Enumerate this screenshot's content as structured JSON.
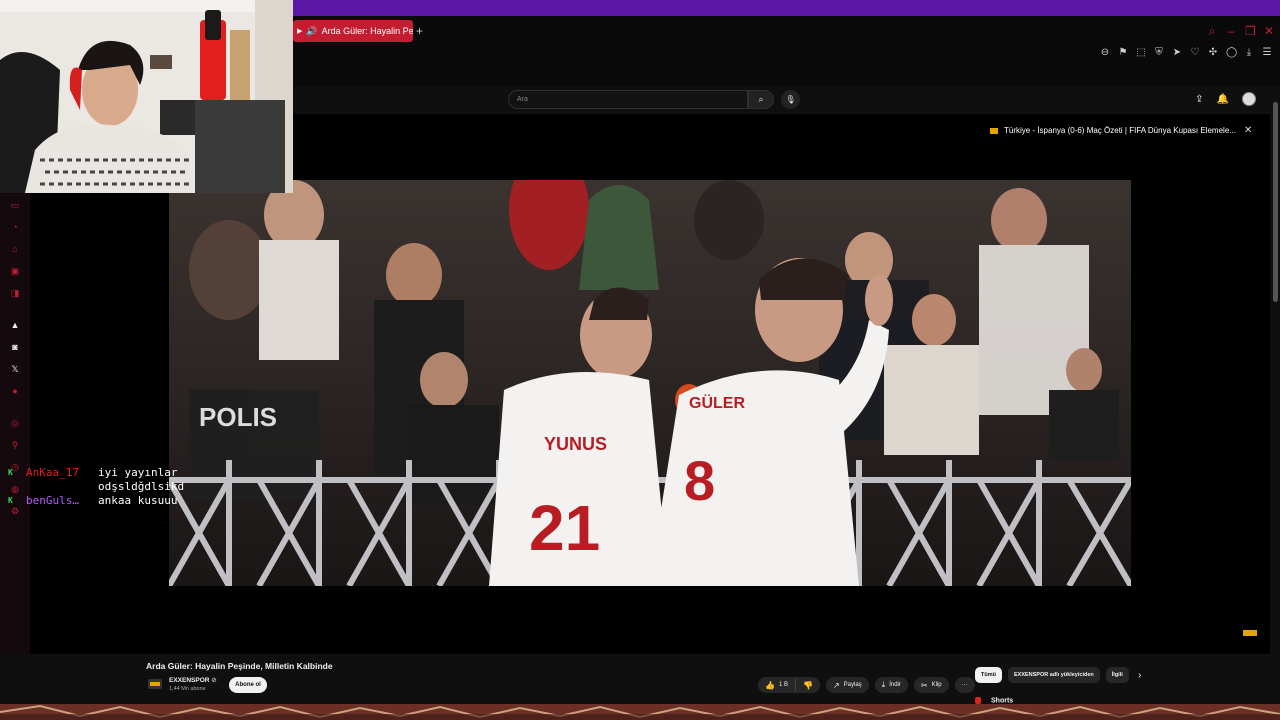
{
  "browser": {
    "tab_title": "Arda Güler: Hayalin Pe",
    "new_tab_symbol": "+"
  },
  "youtube": {
    "search_placeholder": "Ara",
    "overlay_title": "Türkiye - İspanya (0-6) Maç Özeti | FIFA Dünya Kupası Elemele...",
    "video_title": "Arda Güler: Hayalin Peşinde, Milletin Kalbinde",
    "channel_name": "EXXENSPOR",
    "verified_mark": "⊘",
    "subscribers": "1,44 Mn abone",
    "subscribe_label": "Abone ol",
    "likes": "1 B",
    "share_label": "Paylaş",
    "download_label": "İndir",
    "clip_label": "Klip",
    "more_label": "···",
    "chips": [
      "Tümü",
      "EXXENSPOR adlı yükleyiciden",
      "İlgili"
    ],
    "shorts_label": "Shorts"
  },
  "chat": [
    {
      "user": "AnKaa_17",
      "message": "iyi yayınlar",
      "color": "#e02020"
    },
    {
      "user": "",
      "message": "odşsldğdlsikd",
      "color": "#e02020"
    },
    {
      "user": "benGuls…",
      "message": "ankaa kusuuu",
      "color": "#b35cff"
    }
  ],
  "video_frame": {
    "jersey_back_left": "YUNUS",
    "jersey_number_left": "21",
    "jersey_back_right": "GÜLER",
    "jersey_number_right": "8",
    "police_text": "POLIS"
  },
  "icons": {
    "window_controls": [
      "search-icon",
      "minimize-icon",
      "restore-icon",
      "close-icon"
    ],
    "sidebar": [
      "gx-control-icon",
      "gx-corner-icon",
      "gx-cleaner-icon",
      "twitch-icon",
      "discord-icon",
      "aria-icon",
      "twitch-badge-icon",
      "x-icon",
      "music-icon",
      "player-icon",
      "pin-icon",
      "history-icon",
      "settings-icon",
      "gx-logo-icon"
    ]
  },
  "colors": {
    "accent_purple": "#5a17a6",
    "gx_red": "#c41d32",
    "youtube_red": "#e62117",
    "exxen_yellow": "#e5a400"
  }
}
